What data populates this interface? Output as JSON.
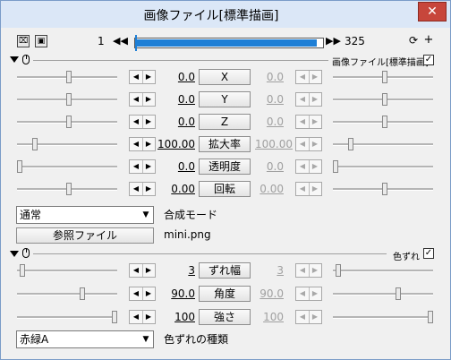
{
  "window": {
    "title": "画像ファイル[標準描画]",
    "close": "✕"
  },
  "toolbar": {
    "frame_start": "1",
    "frame_end": "325",
    "timeline_progress": 0.97
  },
  "section1": {
    "label": "画像ファイル[標準描画]",
    "checked": true
  },
  "params1": [
    {
      "name": "X",
      "left": "0.0",
      "right": "0.0",
      "slider_l": 0.52,
      "slider_r": 0.52
    },
    {
      "name": "Y",
      "left": "0.0",
      "right": "0.0",
      "slider_l": 0.52,
      "slider_r": 0.52
    },
    {
      "name": "Z",
      "left": "0.0",
      "right": "0.0",
      "slider_l": 0.52,
      "slider_r": 0.52
    },
    {
      "name": "拡大率",
      "left": "100.00",
      "right": "100.00",
      "slider_l": 0.16,
      "slider_r": 0.16
    },
    {
      "name": "透明度",
      "left": "0.0",
      "right": "0.0",
      "slider_l": 0.0,
      "slider_r": 0.0
    },
    {
      "name": "回転",
      "left": "0.00",
      "right": "0.00",
      "slider_l": 0.52,
      "slider_r": 0.52
    }
  ],
  "blend": {
    "value": "通常",
    "label": "合成モード"
  },
  "file": {
    "button": "参照ファイル",
    "name": "mini.png"
  },
  "section2": {
    "label": "色ずれ",
    "checked": true
  },
  "params2": [
    {
      "name": "ずれ幅",
      "left": "3",
      "right": "3",
      "slider_l": 0.03,
      "slider_r": 0.03
    },
    {
      "name": "角度",
      "left": "90.0",
      "right": "90.0",
      "slider_l": 0.66,
      "slider_r": 0.66
    },
    {
      "name": "強さ",
      "left": "100",
      "right": "100",
      "slider_l": 1.0,
      "slider_r": 1.0
    }
  ],
  "shift_type": {
    "value": "赤緑A",
    "label": "色ずれの種類"
  }
}
